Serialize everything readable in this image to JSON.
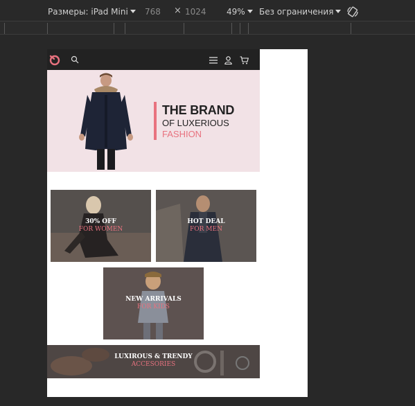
{
  "devtools": {
    "dimensions_label": "Размеры: iPad Mini",
    "width": "768",
    "times": "×",
    "height": "1024",
    "zoom": "49%",
    "throttle": "Без ограничения",
    "rotate_icon": "rotate-icon"
  },
  "site": {
    "header": {
      "logo_icon": "brand-logo-icon",
      "search_icon": "search-icon",
      "menu_icon": "hamburger-menu-icon",
      "account_icon": "user-icon",
      "cart_icon": "cart-icon"
    },
    "hero": {
      "line1": "THE BRAND",
      "line2": "OF LUXERIOUS",
      "line3": "FASHION"
    },
    "tiles": [
      {
        "line1": "30% OFF",
        "line2": "FOR WOMEN"
      },
      {
        "line1": "HOT DEAL",
        "line2": "FOR MEN"
      },
      {
        "line1": "NEW ARRIVALS",
        "line2": "FOR KIDS"
      },
      {
        "line1": "LUXIROUS & TRENDY",
        "line2": "ACCESORIES"
      }
    ]
  },
  "colors": {
    "accent": "#e8727f",
    "hero_bg": "#f2e2e6",
    "header_bg": "#222222",
    "devtools_bg": "#282828"
  }
}
